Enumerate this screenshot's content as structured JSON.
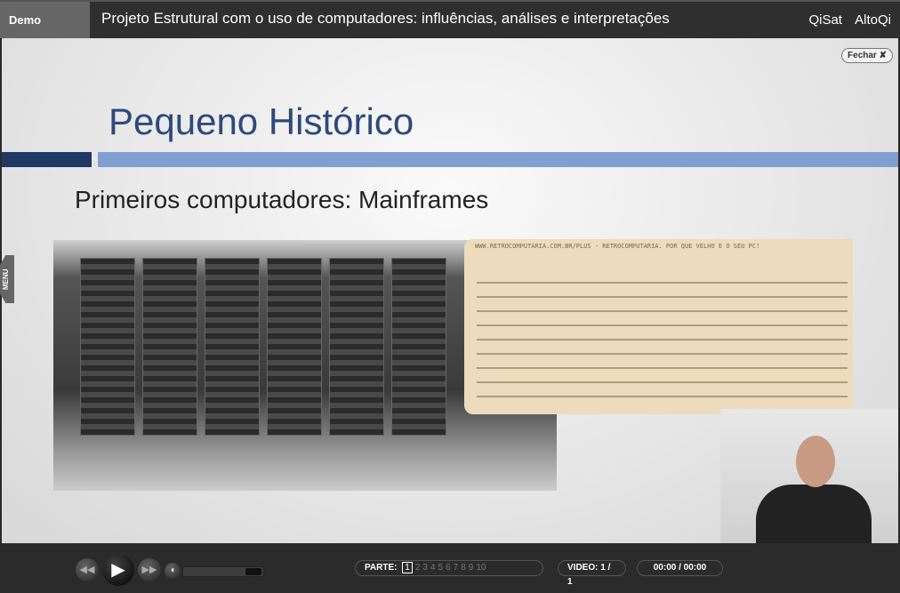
{
  "header": {
    "demo_label": "Demo",
    "title": "Projeto Estrutural com o uso de computadores: influências, análises e interpretações",
    "logos": [
      "QiSat",
      "AltoQi"
    ]
  },
  "slide": {
    "close_label": "Fechar",
    "heading": "Pequeno Histórico",
    "subheading": "Primeiros computadores: Mainframes",
    "punch_card_text": "WWW.RETROCOMPUTARIA.COM.BR/PLUS - RETROCOMPUTARIA. POR QUE VELHO E O SEU PC!",
    "colors": {
      "heading": "#2e4a7a",
      "bar_dark": "#1f3864",
      "bar_light": "#7f9fd0"
    }
  },
  "menu_tab": "MENU",
  "player": {
    "parte_label": "PARTE:",
    "parts": [
      "1",
      "2",
      "3",
      "4",
      "5",
      "6",
      "7",
      "8",
      "9",
      "10"
    ],
    "current_part": "1",
    "video_label": "VIDEO: 1 / 1",
    "time": "00:00 / 00:00",
    "volume_percent": 85
  }
}
